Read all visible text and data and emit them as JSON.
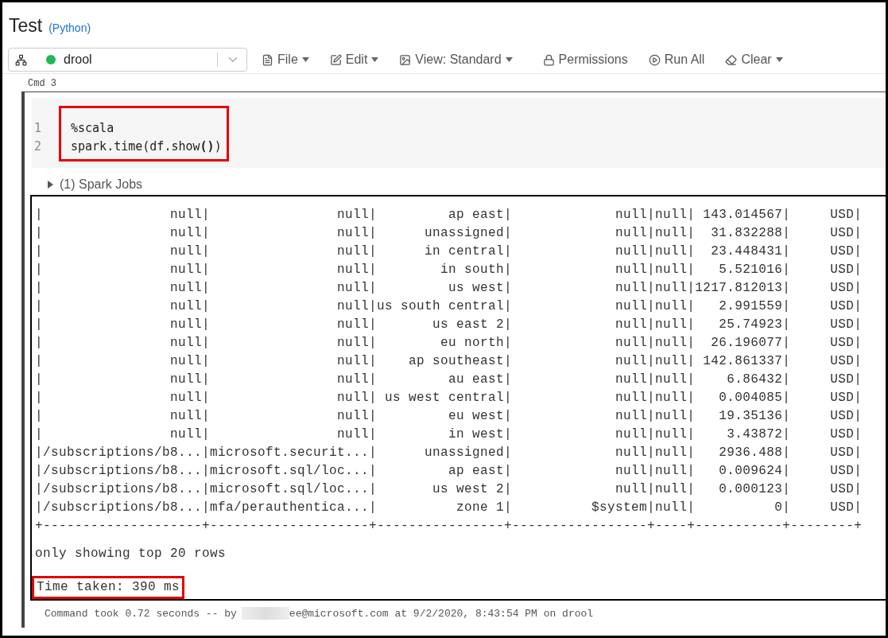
{
  "notebook": {
    "title": "Test",
    "language": "(Python)"
  },
  "toolbar": {
    "cluster": {
      "name": "drool",
      "running": true
    },
    "menu": [
      {
        "kind": "file",
        "label": "File",
        "dropdown": true
      },
      {
        "kind": "edit",
        "label": "Edit",
        "dropdown": true
      },
      {
        "kind": "view",
        "label": "View: Standard",
        "dropdown": true
      },
      {
        "kind": "lock",
        "label": "Permissions",
        "dropdown": false
      },
      {
        "kind": "run",
        "label": "Run All",
        "dropdown": false
      },
      {
        "kind": "clear",
        "label": "Clear",
        "dropdown": true
      }
    ]
  },
  "cell": {
    "label": "Cmd 3",
    "code_highlighted": true,
    "code": [
      {
        "number": "1",
        "text": "%scala"
      },
      {
        "number": "2",
        "text": "spark.time(df.show**()**)"
      }
    ],
    "jobs": {
      "label": "(1) Spark Jobs",
      "expanded": false
    },
    "output": {
      "lines": [
        "|                null|                null|         ap east|             null|null| 143.014567|     USD|",
        "|                null|                null|      unassigned|             null|null|  31.832288|     USD|",
        "|                null|                null|      in central|             null|null|  23.448431|     USD|",
        "|                null|                null|        in south|             null|null|   5.521016|     USD|",
        "|                null|                null|         us west|             null|null|1217.812013|     USD|",
        "|                null|                null|us south central|             null|null|   2.991559|     USD|",
        "|                null|                null|       us east 2|             null|null|   25.74923|     USD|",
        "|                null|                null|        eu north|             null|null|  26.196077|     USD|",
        "|                null|                null|    ap southeast|             null|null| 142.861337|     USD|",
        "|                null|                null|         au east|             null|null|    6.86432|     USD|",
        "|                null|                null| us west central|             null|null|   0.004085|     USD|",
        "|                null|                null|         eu west|             null|null|   19.35136|     USD|",
        "|                null|                null|         in west|             null|null|    3.43872|     USD|",
        "|/subscriptions/b8...|microsoft.securit...|      unassigned|             null|null|   2936.488|     USD|",
        "|/subscriptions/b8...|microsoft.sql/loc...|         ap east|             null|null|   0.009624|     USD|",
        "|/subscriptions/b8...|microsoft.sql/loc...|       us west 2|             null|null|   0.000123|     USD|",
        "|/subscriptions/b8...|mfa/perauthentica...|          zone 1|          $system|null|          0|     USD|",
        "+--------------------+--------------------+----------------+-----------------+----+-----------+--------+"
      ],
      "note": "only showing top 20 rows",
      "timing": "Time taken: 390 ms",
      "timing_highlighted": true
    },
    "footer": {
      "before": "Command took 0.72 seconds -- by",
      "after": "ee@microsoft.com at 9/2/2020, 8:43:54 PM on drool"
    }
  }
}
